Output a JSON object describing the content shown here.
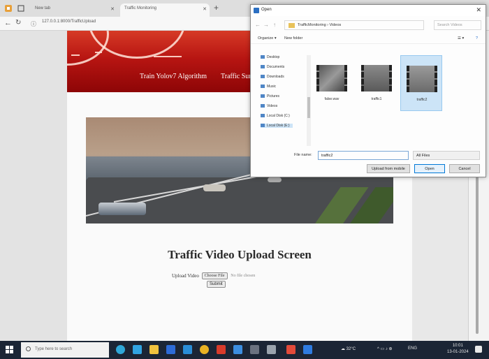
{
  "browser": {
    "tabs": [
      {
        "label": "New tab"
      },
      {
        "label": "Traffic Monitoring"
      }
    ],
    "address": "127.0.0.1:8000/TrafficUpload",
    "new_tab_glyph": "+"
  },
  "site": {
    "nav_links": [
      "Train Yolov7 Algorithm",
      "Traffic Surv"
    ],
    "heading": "Traffic Video Upload Screen",
    "upload_label": "Upload Video",
    "choose_file_label": "Choose File",
    "no_file_text": "No file chosen",
    "submit_label": "Submit"
  },
  "dialog": {
    "title": "Open",
    "breadcrumb": "TrafficMonitoring  ›  Videos",
    "search_placeholder": "Search Videos",
    "toolbar": {
      "organize": "Organize ▾",
      "new_folder": "New folder"
    },
    "nav_items": [
      "Desktop",
      "Documents",
      "Downloads",
      "Music",
      "Pictures",
      "Videos",
      "Local Disk (C:)",
      "Local Disk (E:)"
    ],
    "selected_nav_index": 7,
    "files": [
      {
        "name": "false.wav",
        "selected": false
      },
      {
        "name": "traffic1",
        "selected": false
      },
      {
        "name": "traffic2",
        "selected": true
      }
    ],
    "file_name_label": "File name:",
    "file_name_value": "traffic2",
    "file_type": "All Files",
    "buttons": {
      "upload_mobile": "Upload from mobile",
      "open": "Open",
      "cancel": "Cancel"
    }
  },
  "taskbar": {
    "search_placeholder": "Type here to search",
    "tray_weather": "32°C",
    "tray_lang": "ENG",
    "time": "10:01",
    "date": "13-01-2024"
  },
  "colors": {
    "banner_red": "#b71512",
    "taskbar": "#1b2535",
    "dialog_accent": "#0078d7"
  }
}
